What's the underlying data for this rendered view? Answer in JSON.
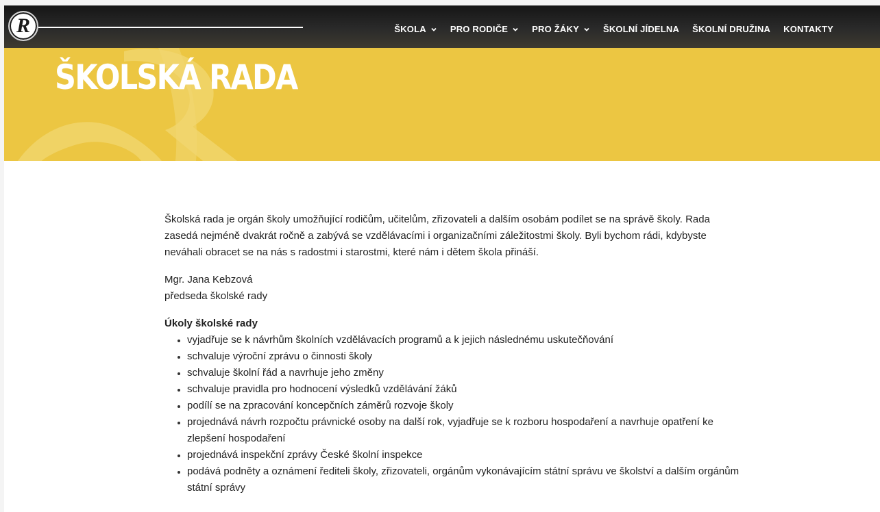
{
  "header": {
    "logo_letter": "R",
    "nav": [
      {
        "label": "ŠKOLA",
        "dropdown": true
      },
      {
        "label": "PRO RODIČE",
        "dropdown": true
      },
      {
        "label": "PRO ŽÁKY",
        "dropdown": true
      },
      {
        "label": "ŠKOLNÍ JÍDELNA",
        "dropdown": false
      },
      {
        "label": "ŠKOLNÍ DRUŽINA",
        "dropdown": false
      },
      {
        "label": "KONTAKTY",
        "dropdown": false
      }
    ]
  },
  "hero": {
    "title": "ŠKOLSKÁ RADA",
    "background_color": "#ecc642"
  },
  "content": {
    "intro": "Školská rada je orgán školy umožňující rodičům, učitelům, zřizovateli a dalším osobám podílet se na správě školy. Rada zasedá nejméně dvakrát ročně a zabývá se vzdělávacími i organizačními záležitostmi školy. Byli bychom rádi, kdybyste neváhali obracet se na nás s radostmi i starostmi, které nám i dětem škola přináší.",
    "signature_name": "Mgr. Jana Kebzová",
    "signature_role": "předseda školské rady",
    "tasks_title": "Úkoly školské rady",
    "tasks": [
      "vyjadřuje se k návrhům školních vzdělávacích programů a k jejich následnému uskutečňování",
      "schvaluje výroční zprávu o činnosti školy",
      "schvaluje školní řád a navrhuje jeho změny",
      "schvaluje pravidla pro hodnocení výsledků vzdělávání žáků",
      "podílí se na zpracování koncepčních záměrů rozvoje školy",
      "projednává návrh rozpočtu právnické osoby na další rok, vyjadřuje se k rozboru hospodaření a navrhuje opatření ke zlepšení hospodaření",
      "projednává inspekční zprávy České školní inspekce",
      "podává podněty a oznámení řediteli školy, zřizovateli, orgánům vykonávajícím státní správu ve školství a dalším orgánům státní správy"
    ]
  }
}
